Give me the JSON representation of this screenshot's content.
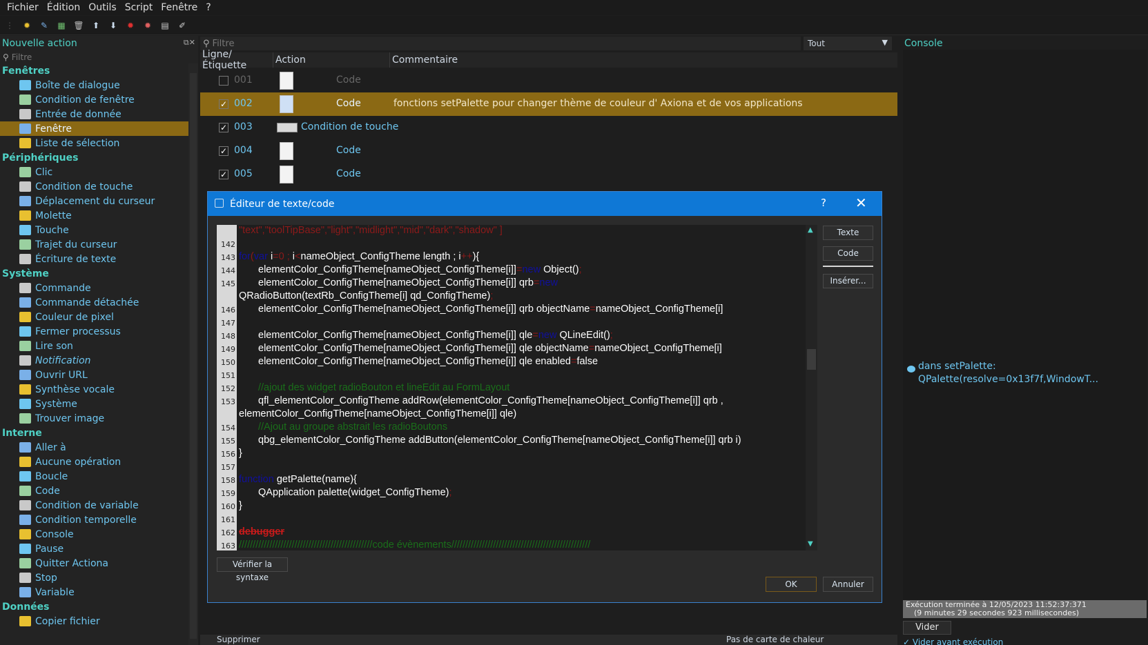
{
  "menu": [
    "Fichier",
    "Édition",
    "Outils",
    "Script",
    "Fenêtre",
    "?"
  ],
  "left_panel": {
    "title": "Nouvelle action",
    "filter_placeholder": "Filtre",
    "categories": [
      {
        "label": "Fenêtres",
        "items": [
          "Boîte de dialogue",
          "Condition de fenêtre",
          "Entrée de donnée",
          "Fenêtre",
          "Liste de sélection"
        ]
      },
      {
        "label": "Périphériques",
        "items": [
          "Clic",
          "Condition de touche",
          "Déplacement du curseur",
          "Molette",
          "Touche",
          "Trajet du curseur",
          "Écriture de texte"
        ]
      },
      {
        "label": "Système",
        "items": [
          "Commande",
          "Commande détachée",
          "Couleur de pixel",
          "Fermer processus",
          "Lire son",
          "Notification",
          "Ouvrir URL",
          "Synthèse vocale",
          "Système",
          "Trouver image"
        ]
      },
      {
        "label": "Interne",
        "items": [
          "Aller à",
          "Aucune opération",
          "Boucle",
          "Code",
          "Condition de variable",
          "Condition temporelle",
          "Console",
          "Pause",
          "Quitter Actiona",
          "Stop",
          "Variable"
        ]
      },
      {
        "label": "Données",
        "items": [
          "Copier fichier"
        ]
      }
    ],
    "selected_item": "Fenêtre"
  },
  "center": {
    "filter_placeholder": "Filtre",
    "filter_select": "Tout",
    "columns": [
      "Ligne/Étiquette",
      "Action",
      "Commentaire"
    ],
    "rows": [
      {
        "num": "001",
        "action": "Code",
        "comment": "",
        "checked": false
      },
      {
        "num": "002",
        "action": "Code",
        "comment": "fonctions setPalette pour changer thème de couleur d' Axiona et de vos applications",
        "checked": true
      },
      {
        "num": "003",
        "action": "Condition de touche",
        "comment": "",
        "checked": true
      },
      {
        "num": "004",
        "action": "Code",
        "comment": "",
        "checked": true
      },
      {
        "num": "005",
        "action": "Code",
        "comment": "",
        "checked": true
      }
    ],
    "bottom_left": "Supprimer",
    "bottom_right": "Pas de carte de chaleur"
  },
  "dialog": {
    "title": "Éditeur de texte/code",
    "help": "?",
    "buttons": {
      "text": "Texte",
      "code": "Code",
      "insert": "Insérer...",
      "verify": "Vérifier la syntaxe",
      "ok": "OK",
      "cancel": "Annuler"
    },
    "line_numbers": [
      "142",
      "143",
      "144",
      "145",
      "146",
      "147",
      "148",
      "149",
      "150",
      "151",
      "152",
      "153",
      "154",
      "155",
      "156",
      "157",
      "158",
      "159",
      "160",
      "161",
      "162",
      "163"
    ],
    "code": {
      "l0": "\"text\",\"toolTipBase\",\"light\",\"midlight\",\"mid\",\"dark\",\"shadow\" ]",
      "l143a": "for",
      "l143b": "(",
      "l143c": "var",
      "l143d": " i",
      "l143e": "=0 ; ",
      "l143f": "i",
      "l143g": "<",
      "l143h": "nameObject_ConfigTheme length ; ",
      "l143i": "i",
      "l143j": "++",
      "l143k": "){",
      "l144a": "elementColor_ConfigTheme[nameObject_ConfigTheme[i]]",
      "l144b": "=",
      "l144c": "new",
      "l144d": " Object()",
      "l144e": ";",
      "l145a": "elementColor_ConfigTheme[nameObject_ConfigTheme[i]] qrb",
      "l145b": "=",
      "l145c": "new",
      "l145d": "QRadioButton(textRb_ConfigTheme[i] qd_ConfigTheme)",
      "l145e": ";",
      "l146a": "elementColor_ConfigTheme[nameObject_ConfigTheme[i]] qrb objectName",
      "l146b": "=",
      "l146c": "nameObject_ConfigTheme[i]",
      "l148a": "elementColor_ConfigTheme[nameObject_ConfigTheme[i]] qle",
      "l148b": "=",
      "l148c": "new",
      "l148d": " QLineEdit()",
      "l148e": ";",
      "l149a": "elementColor_ConfigTheme[nameObject_ConfigTheme[i]] qle objectName",
      "l149b": "=",
      "l149c": "nameObject_ConfigTheme[i]",
      "l150a": "elementColor_ConfigTheme[nameObject_ConfigTheme[i]] qle enabled",
      "l150b": "=",
      "l150c": "false",
      "l152": "//ajout des widget radioBouton et lineEdit au FormLayout",
      "l153a": "qfl_elementColor_ConfigTheme addRow(elementColor_ConfigTheme[nameObject_ConfigTheme[i]] qrb ,",
      "l153b": "elementColor_ConfigTheme[nameObject_ConfigTheme[i]] qle)",
      "l154": "//Ajout au groupe abstrait les radioBoutons",
      "l155": "qbg_elementColor_ConfigTheme addButton(elementColor_ConfigTheme[nameObject_ConfigTheme[i]] qrb i)",
      "l156": "}",
      "l158a": "function",
      "l158b": " getPalette(name){",
      "l159a": "QApplication palette(widget_ConfigTheme)",
      "l159b": ";",
      "l160": "}",
      "l162": "debugger",
      "l163a": "////////////////////////////////////////////////",
      "l163b": "code évènements",
      "l163c": "//////////////////////////////////////////////////"
    }
  },
  "console": {
    "title": "Console",
    "message_line1": "dans setPalette:",
    "message_line2": "QPalette(resolve=0x13f7f,WindowT...",
    "status_line1": "Exécution terminée à 12/05/2023 11:52:37:371",
    "status_line2": "(9 minutes 29 secondes 923 millisecondes)",
    "clear": "Vider",
    "clear_before": "Vider avant exécution"
  },
  "colors": {
    "accent": "#4fd1c5",
    "selection": "#8b6914",
    "dialog_title": "#0f78d6",
    "link": "#6ec6f0"
  }
}
